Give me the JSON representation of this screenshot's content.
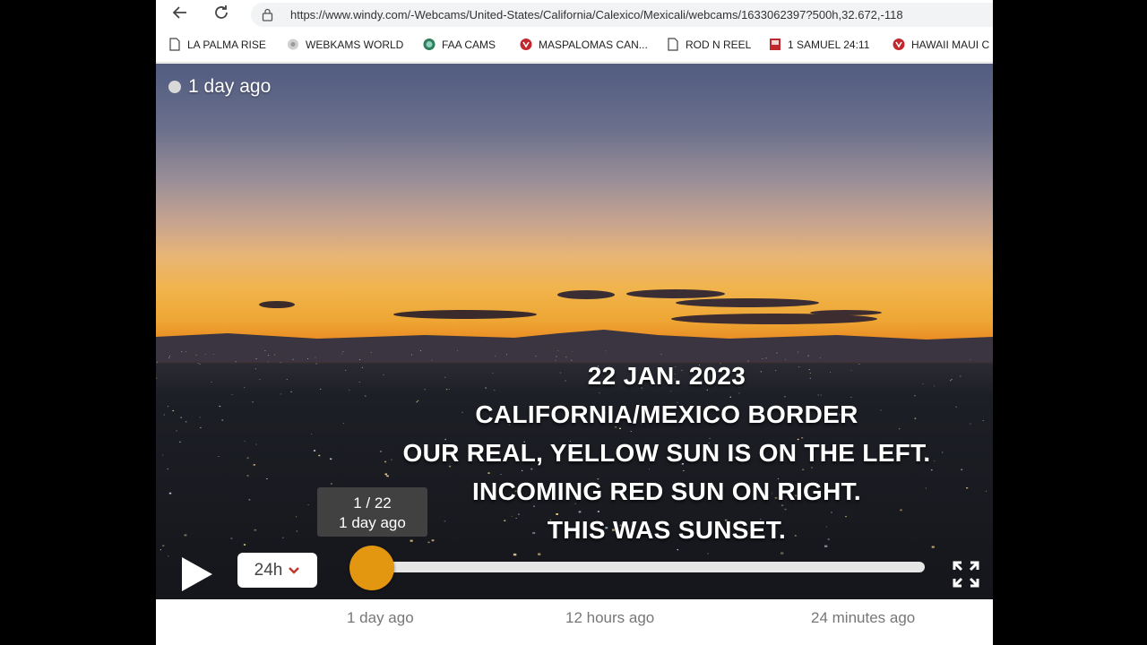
{
  "browser": {
    "url": "https://www.windy.com/-Webcams/United-States/California/Calexico/Mexicali/webcams/1633062397?500h,32.672,-118",
    "bookmarks": [
      {
        "label": "LA PALMA RISE",
        "icon": "page-icon"
      },
      {
        "label": "WEBKAMS WORLD",
        "icon": "globe-icon"
      },
      {
        "label": "FAA CAMS",
        "icon": "faa-icon"
      },
      {
        "label": "MASPALOMAS CAN...",
        "icon": "vivaldi-icon"
      },
      {
        "label": "ROD N REEL",
        "icon": "page-icon"
      },
      {
        "label": "1 SAMUEL 24:11",
        "icon": "bookmark-red-icon"
      },
      {
        "label": "HAWAII MAUI C",
        "icon": "vivaldi-icon"
      }
    ]
  },
  "webcam": {
    "age_label": "1 day ago",
    "caption_lines": [
      "22 JAN. 2023",
      "CALIFORNIA/MEXICO BORDER",
      "OUR REAL, YELLOW SUN IS ON THE LEFT.",
      "INCOMING RED SUN ON RIGHT.",
      "THIS WAS SUNSET."
    ]
  },
  "player": {
    "tooltip_index": "1 / 22",
    "tooltip_age": "1 day ago",
    "period_label": "24h",
    "position": 0.0,
    "scale_labels": [
      "1 day ago",
      "12 hours ago",
      "24 minutes ago"
    ]
  },
  "colors": {
    "knob": "#e3960f",
    "track": "#e6e6e6"
  }
}
